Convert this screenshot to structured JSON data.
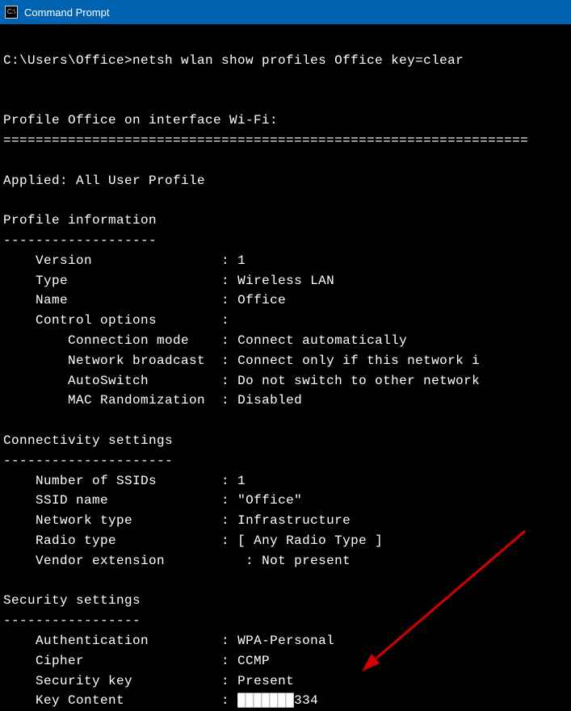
{
  "window": {
    "title": "Command Prompt"
  },
  "prompt": {
    "path": "C:\\Users\\Office>",
    "command": "netsh wlan show profiles Office key=clear"
  },
  "header": {
    "line": "Profile Office on interface Wi-Fi:",
    "divider": "================================================================="
  },
  "applied": "Applied: All User Profile",
  "sections": {
    "profile_info": {
      "title": "Profile information",
      "divider": "-------------------",
      "rows": [
        {
          "label": "    Version",
          "sep": "                : ",
          "value": "1"
        },
        {
          "label": "    Type",
          "sep": "                   : ",
          "value": "Wireless LAN"
        },
        {
          "label": "    Name",
          "sep": "                   : ",
          "value": "Office"
        },
        {
          "label": "    Control options",
          "sep": "        :",
          "value": ""
        },
        {
          "label": "        Connection mode",
          "sep": "    : ",
          "value": "Connect automatically"
        },
        {
          "label": "        Network broadcast",
          "sep": "  : ",
          "value": "Connect only if this network i"
        },
        {
          "label": "        AutoSwitch",
          "sep": "         : ",
          "value": "Do not switch to other network"
        },
        {
          "label": "        MAC Randomization",
          "sep": "  : ",
          "value": "Disabled"
        }
      ]
    },
    "connectivity": {
      "title": "Connectivity settings",
      "divider": "---------------------",
      "rows": [
        {
          "label": "    Number of SSIDs",
          "sep": "        : ",
          "value": "1"
        },
        {
          "label": "    SSID name",
          "sep": "              : ",
          "value": "\"Office\""
        },
        {
          "label": "    Network type",
          "sep": "           : ",
          "value": "Infrastructure"
        },
        {
          "label": "    Radio type",
          "sep": "             : ",
          "value": "[ Any Radio Type ]"
        },
        {
          "label": "    Vendor extension",
          "sep": "          : ",
          "value": "Not present"
        }
      ]
    },
    "security": {
      "title": "Security settings",
      "divider": "-----------------",
      "rows": [
        {
          "label": "    Authentication",
          "sep": "         : ",
          "value": "WPA-Personal"
        },
        {
          "label": "    Cipher",
          "sep": "                 : ",
          "value": "CCMP"
        },
        {
          "label": "    Security key",
          "sep": "           : ",
          "value": "Present"
        },
        {
          "label": "    Key Content",
          "sep": "            : ",
          "value": "███████334"
        }
      ]
    }
  }
}
